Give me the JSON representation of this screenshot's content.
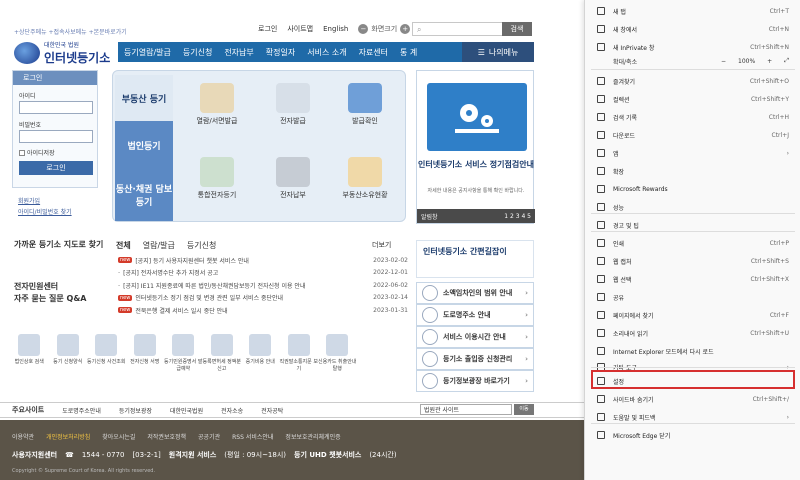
{
  "top": {
    "links": "+상단주메뉴 +접속사보메뉴 +본문바로가기",
    "login": "로그인",
    "sitemap": "사이트맵",
    "english": "English",
    "zoom_label": "화면크기",
    "search_button": "검색"
  },
  "logo": {
    "small": "대한민국 법원",
    "name": "인터넷등기소"
  },
  "nav": {
    "items": [
      "등기열람/발급",
      "등기신청",
      "전자납부",
      "확정일자",
      "서비스 소개",
      "자료센터",
      "통 계"
    ],
    "my_menu": "나의메뉴"
  },
  "login_panel": {
    "title": "로그인",
    "id_label": "아이디",
    "pw_label": "비밀번호",
    "keep_label": "아이디저장",
    "button": "로그인",
    "join": "회원가입",
    "find": "아이디/비밀번호 찾기"
  },
  "categories": [
    "부동산 등기",
    "법인등기",
    "동산·채권 담보 등기"
  ],
  "services": [
    "열람/서면발급",
    "전자발급",
    "발급확인",
    "통합전자등기",
    "전자납부",
    "부동산소유현황"
  ],
  "banner": {
    "title": "인터넷등기소 서비스 정기점검안내",
    "sub": "자세한 내용은 공지사항을 통해 확인 바랍니다.",
    "bar_left": "알림창",
    "pages": "1 2 3 4 5"
  },
  "quick_left": [
    {
      "label": "가까운 등기소 지도로 찾기"
    },
    {
      "label": "전자민원센터"
    },
    {
      "label": "자주 묻는 질문 Q&A"
    }
  ],
  "news": {
    "tabs": [
      "전체",
      "열람/발급",
      "등기신청"
    ],
    "more": "더보기",
    "items": [
      {
        "new": true,
        "title": "[공지] 등기 사용자지원센터 챗봇 서비스 안내",
        "date": "2023-02-02"
      },
      {
        "new": false,
        "title": "[공지] 전자서명수단 추가 지정서 공고",
        "date": "2022-12-01"
      },
      {
        "new": false,
        "title": "[공지] IE11 지원종료에 따른 법인/동산채권담보등기 전자신청 이용 안내",
        "date": "2022-06-02"
      },
      {
        "new": true,
        "title": "인터넷등기소 정기 점검 및 변경 관련 일부 서비스 중단안내",
        "date": "2023-02-14"
      },
      {
        "new": true,
        "title": "전북은행 결제 서비스 일시 중단 안내",
        "date": "2023-01-31"
      }
    ]
  },
  "right_quick": {
    "top": "인터넷등기소 간편길잡이",
    "items": [
      "소액임차인의 범위 안내",
      "도로명주소 안내",
      "서비스 이용시간 안내",
      "등기소 출입증 신청관리",
      "등기정보광장 바로가기"
    ]
  },
  "icon_row": [
    "법인상호 검색",
    "등기 신청양식",
    "등기신청 사건조회",
    "전자신청 서명",
    "등기민원증명서 발급예약",
    "등록면허세 정액분 신고",
    "증기비용 안내",
    "직권말소통지문 보기",
    "신용카드 취출안내 탈행"
  ],
  "site_bar": {
    "title": "주요사이트",
    "items": [
      "도로명주소안내",
      "등기정보광장",
      "대한민국법원",
      "전자소송",
      "전자공탁"
    ],
    "select": "법원관 사이트",
    "go": "이동"
  },
  "footer": {
    "links": [
      "이용약관",
      "개인정보처리방침",
      "찾아오시는길",
      "저작권보호정책",
      "공공기관",
      "RSS 서비스안내"
    ],
    "highlight_index": 1,
    "cert": "정보보호관리체계인증",
    "call_label": "사용자지원센터",
    "phone": "1544 - 0770",
    "call_extra": "[03-2-1]",
    "remote": "원격지원 서비스",
    "remote_hours": "(평일 : 09시~18시)",
    "chatbot": "등기 UHD 챗봇서비스",
    "chatbot_hours": "(24시간)",
    "copyright": "Copyright © Supreme Court of Korea. All rights reserved."
  },
  "edge_menu": {
    "zoom_label": "확대/축소",
    "zoom_value": "100%",
    "items": [
      {
        "label": "새 탭",
        "shortcut": "Ctrl+T",
        "icon": "new-tab-icon"
      },
      {
        "label": "새 창에서",
        "shortcut": "Ctrl+N",
        "icon": "new-window-icon"
      },
      {
        "label": "새 InPrivate 창",
        "shortcut": "Ctrl+Shift+N",
        "icon": "inprivate-icon"
      },
      {
        "label": "즐겨찾기",
        "shortcut": "Ctrl+Shift+O",
        "icon": "favorites-icon"
      },
      {
        "label": "컬렉션",
        "shortcut": "Ctrl+Shift+Y",
        "icon": "collections-icon"
      },
      {
        "label": "검색 기록",
        "shortcut": "Ctrl+H",
        "icon": "history-icon"
      },
      {
        "label": "다운로드",
        "shortcut": "Ctrl+J",
        "icon": "download-icon"
      },
      {
        "label": "앱",
        "shortcut": "›",
        "icon": "apps-icon"
      },
      {
        "label": "확장",
        "shortcut": "",
        "icon": "extensions-icon"
      },
      {
        "label": "Microsoft Rewards",
        "shortcut": "",
        "icon": "rewards-icon"
      },
      {
        "label": "성능",
        "shortcut": "",
        "icon": "performance-icon"
      },
      {
        "label": "경고 및 팁",
        "shortcut": "",
        "icon": "bell-icon"
      },
      {
        "label": "인쇄",
        "shortcut": "Ctrl+P",
        "icon": "print-icon"
      },
      {
        "label": "웹 캡처",
        "shortcut": "Ctrl+Shift+S",
        "icon": "capture-icon"
      },
      {
        "label": "웹 선택",
        "shortcut": "Ctrl+Shift+X",
        "icon": "web-select-icon"
      },
      {
        "label": "공유",
        "shortcut": "",
        "icon": "share-icon"
      },
      {
        "label": "페이지에서 찾기",
        "shortcut": "Ctrl+F",
        "icon": "find-icon"
      },
      {
        "label": "소리내어 읽기",
        "shortcut": "Ctrl+Shift+U",
        "icon": "read-aloud-icon"
      },
      {
        "label": "Internet Explorer 모드에서 다시 로드",
        "shortcut": "",
        "icon": "ie-icon"
      },
      {
        "label": "기타 도구",
        "shortcut": "›",
        "icon": "more-tools-icon"
      },
      {
        "label": "설정",
        "shortcut": "",
        "icon": "gear-icon"
      },
      {
        "label": "사이드바 숨기기",
        "shortcut": "Ctrl+Shift+/",
        "icon": "sidebar-icon"
      },
      {
        "label": "도움말 및 피드백",
        "shortcut": "›",
        "icon": "help-icon"
      },
      {
        "label": "Microsoft Edge 닫기",
        "shortcut": "",
        "icon": "close-icon"
      }
    ]
  }
}
